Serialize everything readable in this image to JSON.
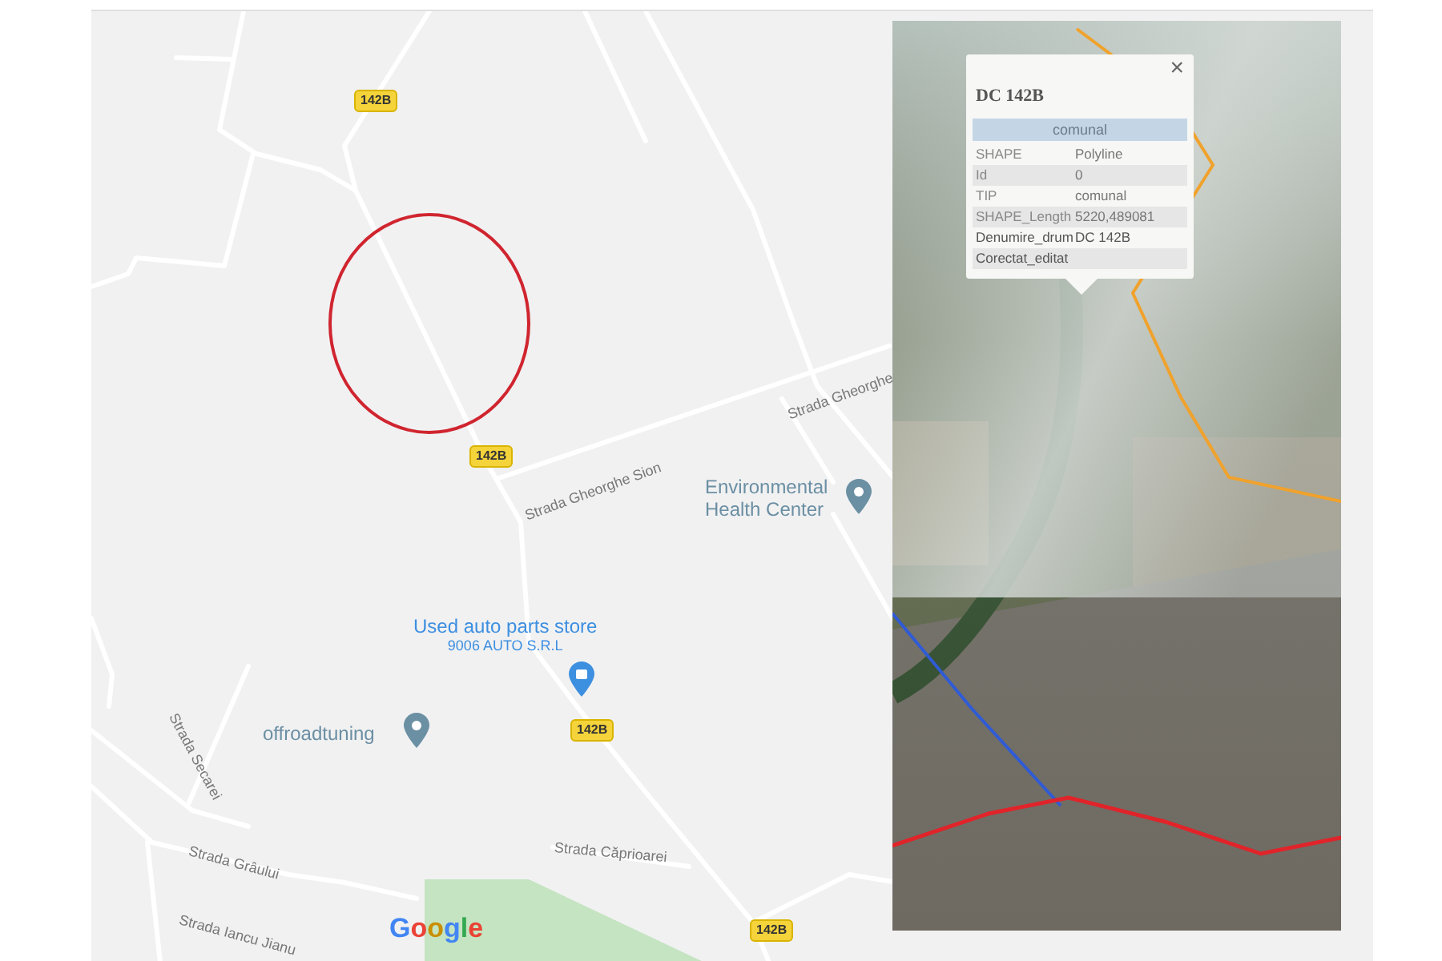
{
  "map": {
    "route_shields": [
      "142B",
      "142B",
      "142B",
      "142B"
    ],
    "places": [
      {
        "kind": "poi",
        "name": "Environmental Health Center",
        "color": "#6b8fa3"
      },
      {
        "kind": "store",
        "name": "Used auto parts store",
        "subtitle": "9006 AUTO S.R.L",
        "color": "#3d8fe0"
      },
      {
        "kind": "poi",
        "name": "offroadtuning",
        "color": "#6b8fa3"
      }
    ],
    "streets": [
      "Strada Gheorghe Sion",
      "Strada Gheorghe",
      "Strada Secarei",
      "Strada Grâului",
      "Strada Căprioarei",
      "Strada Iancu Jianu"
    ],
    "logo": "Google"
  },
  "popup": {
    "title": "DC 142B",
    "header": "comunal",
    "close": "×",
    "rows": [
      {
        "field": "SHAPE",
        "value": "Polyline"
      },
      {
        "field": "Id",
        "value": "0"
      },
      {
        "field": "TIP",
        "value": "comunal"
      },
      {
        "field": "SHAPE_Length",
        "value": "5220,489081"
      },
      {
        "field": "Denumire_drum",
        "value": "DC 142B"
      },
      {
        "field": "Corectat_editat"
      }
    ]
  }
}
